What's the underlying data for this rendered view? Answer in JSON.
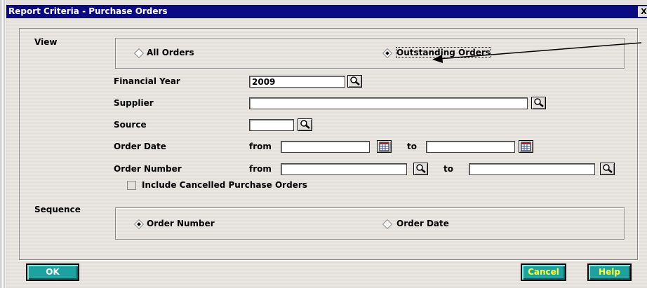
{
  "window": {
    "title": "Report Criteria - Purchase Orders",
    "close_glyph": "X"
  },
  "view": {
    "label": "View",
    "options": [
      {
        "label": "All Orders",
        "selected": false
      },
      {
        "label": "Outstanding Orders",
        "selected": true
      }
    ]
  },
  "fields": {
    "financial_year": {
      "label": "Financial Year",
      "value": "2009"
    },
    "supplier": {
      "label": "Supplier",
      "value": ""
    },
    "source": {
      "label": "Source",
      "value": ""
    },
    "order_date": {
      "label": "Order Date",
      "from_label": "from",
      "to_label": "to",
      "from_value": "",
      "to_value": ""
    },
    "order_number": {
      "label": "Order Number",
      "from_label": "from",
      "to_label": "to",
      "from_value": "",
      "to_value": ""
    },
    "include_cancelled": {
      "label": "Include Cancelled Purchase Orders",
      "checked": false
    }
  },
  "sequence": {
    "label": "Sequence",
    "options": [
      {
        "label": "Order Number",
        "selected": true
      },
      {
        "label": "Order Date",
        "selected": false
      }
    ]
  },
  "buttons": {
    "ok": "OK",
    "cancel": "Cancel",
    "help": "Help"
  },
  "colors": {
    "titlebar": "#0a0a82",
    "button": "#1ea2a0",
    "dialog_bg": "#e4e1dc"
  },
  "icons": {
    "lookup": "magnifier-icon",
    "calendar": "calendar-icon"
  }
}
